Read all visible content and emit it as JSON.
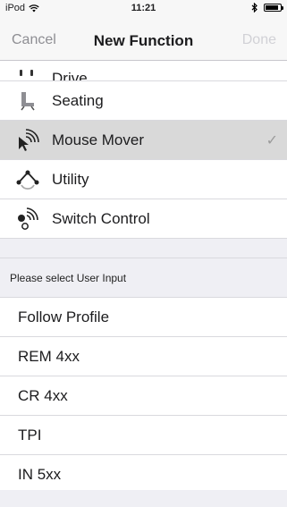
{
  "status_bar": {
    "carrier": "iPod",
    "time": "11:21",
    "battery_level": 0.85
  },
  "nav": {
    "cancel_label": "Cancel",
    "title": "New Function",
    "done_label": "Done"
  },
  "functions": [
    {
      "label": "Drive",
      "icon": "drive-icon"
    },
    {
      "label": "Seating",
      "icon": "seating-icon"
    },
    {
      "label": "Mouse Mover",
      "icon": "mouse-mover-icon",
      "selected": true
    },
    {
      "label": "Utility",
      "icon": "utility-icon"
    },
    {
      "label": "Switch Control",
      "icon": "switch-control-icon"
    }
  ],
  "user_input_header": "Please select User Input",
  "user_inputs": [
    "Follow Profile",
    "REM 4xx",
    "CR 4xx",
    "TPI",
    "IN 5xx"
  ],
  "colors": {
    "accent_disabled": "#d1d1d6",
    "selected_row": "#d9d9d9",
    "background": "#efeff4"
  }
}
